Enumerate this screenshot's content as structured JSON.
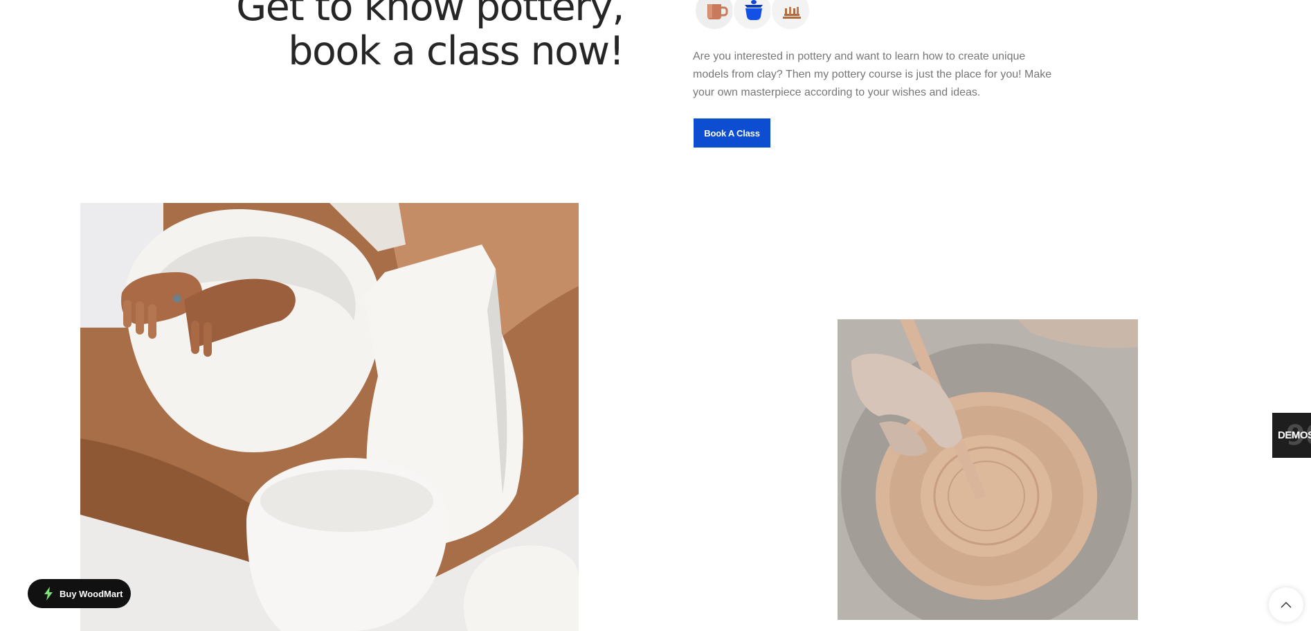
{
  "hero": {
    "headline_line1": "Get to know pottery,",
    "headline_line2": "book a class now!",
    "description": "Are you interested in pottery and want to learn how to create unique models from clay? Then my pottery course is just the place for you! Make your own masterpiece according to your wishes and ideas.",
    "cta_label": "Book A Class",
    "cta_color": "#0c4dd1",
    "icons": [
      "mug-icon",
      "teapot-icon",
      "pottery-set-icon"
    ]
  },
  "gallery": {
    "images": [
      "pottery-vessels-hands-photo",
      "pottery-wheel-carving-photo"
    ]
  },
  "widgets": {
    "demos_label": "DEMOS",
    "buy_label": "Buy WoodMart",
    "buy_icon": "woodmart-bolt-icon",
    "scroll_top_icon": "chevron-up-icon"
  }
}
